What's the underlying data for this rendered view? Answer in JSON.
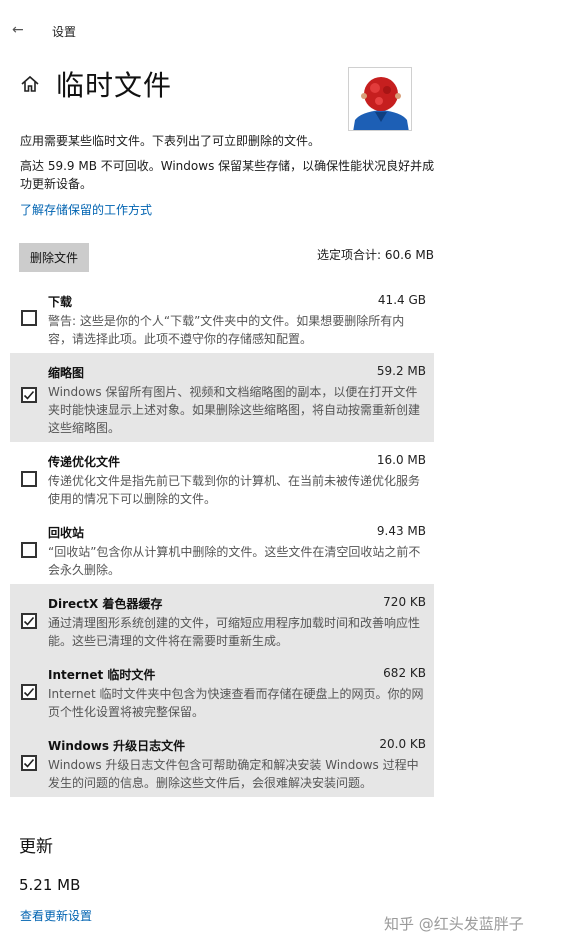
{
  "topbar": {
    "back_icon": "arrow-left-icon",
    "title": "设置"
  },
  "header": {
    "home_icon": "home-icon",
    "title": "临时文件"
  },
  "intro": "应用需要某些临时文件。下表列出了可立即删除的文件。",
  "reserved_text": "高达 59.9 MB 不可回收。Windows 保留某些存储，以确保性能状况良好并成功更新设备。",
  "learn_link": "了解存储保留的工作方式",
  "toolbar": {
    "delete_label": "删除文件",
    "selected_total": "选定项合计: 60.6 MB"
  },
  "items": [
    {
      "name": "下载",
      "size": "41.4 GB",
      "checked": false,
      "desc": "警告: 这些是你的个人“下载”文件夹中的文件。如果想要删除所有内容，请选择此项。此项不遵守你的存储感知配置。"
    },
    {
      "name": "缩略图",
      "size": "59.2 MB",
      "checked": true,
      "desc": "Windows 保留所有图片、视频和文档缩略图的副本，以便在打开文件夹时能快速显示上述对象。如果删除这些缩略图，将自动按需重新创建这些缩略图。"
    },
    {
      "name": "传递优化文件",
      "size": "16.0 MB",
      "checked": false,
      "desc": "传递优化文件是指先前已下载到你的计算机、在当前未被传递优化服务使用的情况下可以删除的文件。"
    },
    {
      "name": "回收站",
      "size": "9.43 MB",
      "checked": false,
      "desc": "“回收站”包含你从计算机中删除的文件。这些文件在清空回收站之前不会永久删除。"
    },
    {
      "name": "DirectX 着色器缓存",
      "size": "720 KB",
      "checked": true,
      "desc": "通过清理图形系统创建的文件，可缩短应用程序加载时间和改善响应性能。这些已清理的文件将在需要时重新生成。"
    },
    {
      "name": "Internet 临时文件",
      "size": "682 KB",
      "checked": true,
      "desc": "Internet 临时文件夹中包含为快速查看而存储在硬盘上的网页。你的网页个性化设置将被完整保留。"
    },
    {
      "name": "Windows 升级日志文件",
      "size": "20.0 KB",
      "checked": true,
      "desc": "Windows 升级日志文件包含可帮助确定和解决安装 Windows 过程中发生的问题的信息。删除这些文件后，会很难解决安装问题。"
    }
  ],
  "update": {
    "title": "更新",
    "size": "5.21 MB",
    "link": "查看更新设置"
  },
  "watermark": "知乎 @红头发蓝胖子",
  "colors": {
    "link": "#0063b1",
    "checked_bg": "#e6e6e6",
    "button_bg": "#cccccc"
  }
}
